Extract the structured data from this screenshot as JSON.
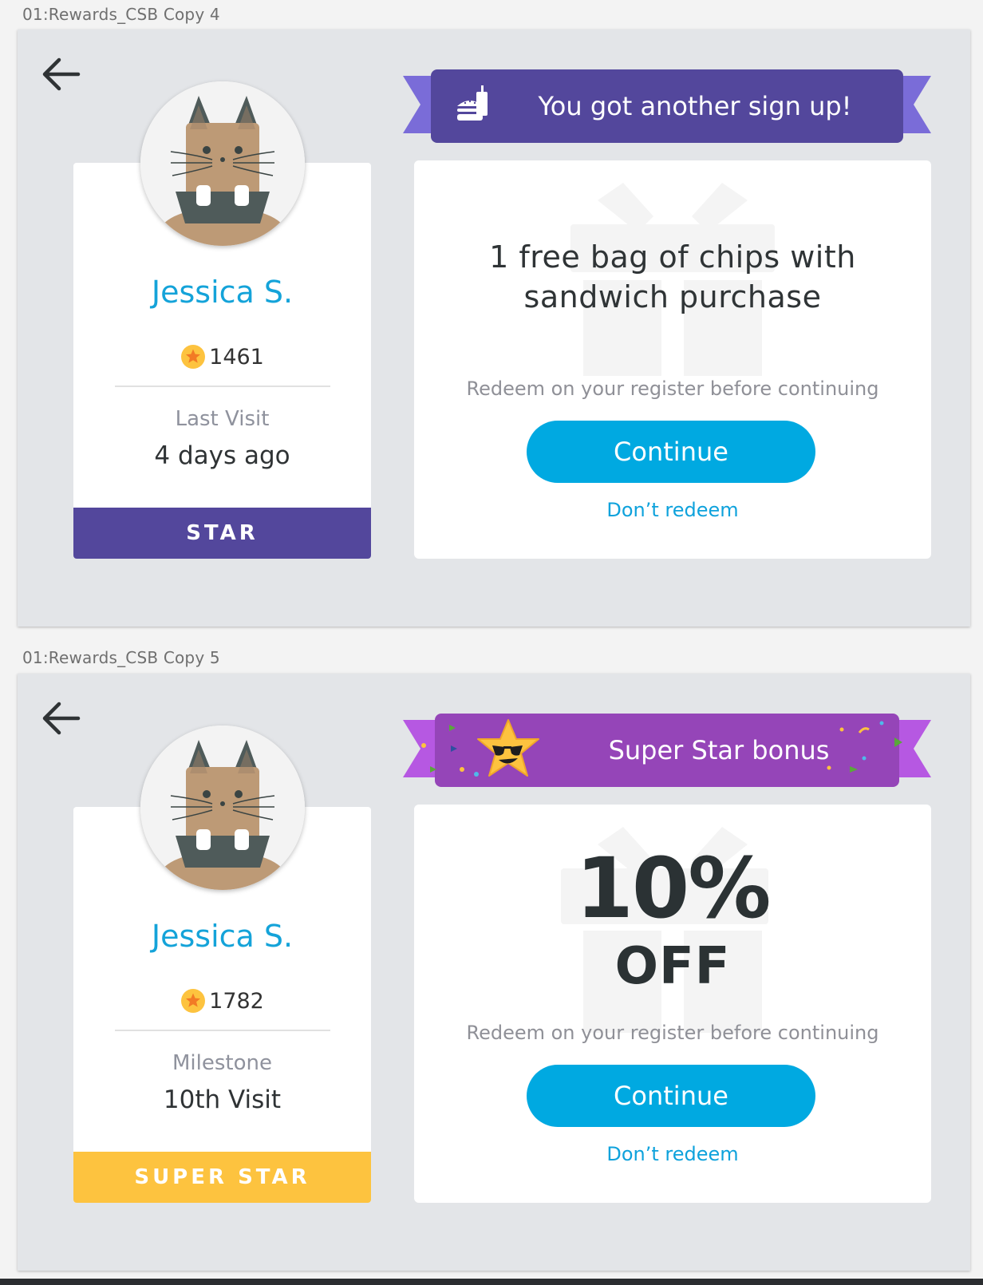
{
  "screens": [
    {
      "artboard_label": "01:Rewards_CSB Copy 4",
      "customer": {
        "name": "Jessica S.",
        "points": "1461",
        "meta_label": "Last Visit",
        "meta_value": "4 days ago",
        "tier": "STAR",
        "tier_color": "#53479c"
      },
      "banner": {
        "text": "You got another sign up!",
        "color": "#53479c",
        "tail_color": "#7a6cd8",
        "icon": "burger-drink-icon"
      },
      "reward": {
        "title": "1 free bag of chips with sandwich purchase",
        "instruction": "Redeem on your register before continuing",
        "continue_label": "Continue",
        "dont_redeem_label": "Don’t redeem"
      }
    },
    {
      "artboard_label": "01:Rewards_CSB Copy 5",
      "customer": {
        "name": "Jessica S.",
        "points": "1782",
        "meta_label": "Milestone",
        "meta_value": "10th Visit",
        "tier": "SUPER STAR",
        "tier_color": "#fdc33f"
      },
      "banner": {
        "text": "Super Star bonus",
        "color": "#9545b8",
        "tail_color": "#b658e2",
        "icon": "star-sunglasses-icon"
      },
      "reward": {
        "big": "10%",
        "off": "OFF",
        "instruction": "Redeem on your register before continuing",
        "continue_label": "Continue",
        "dont_redeem_label": "Don’t redeem"
      }
    }
  ],
  "colors": {
    "accent_blue": "#00a9e1",
    "name_blue": "#14a3d9",
    "artboard_bg": "#e3e5e8"
  }
}
